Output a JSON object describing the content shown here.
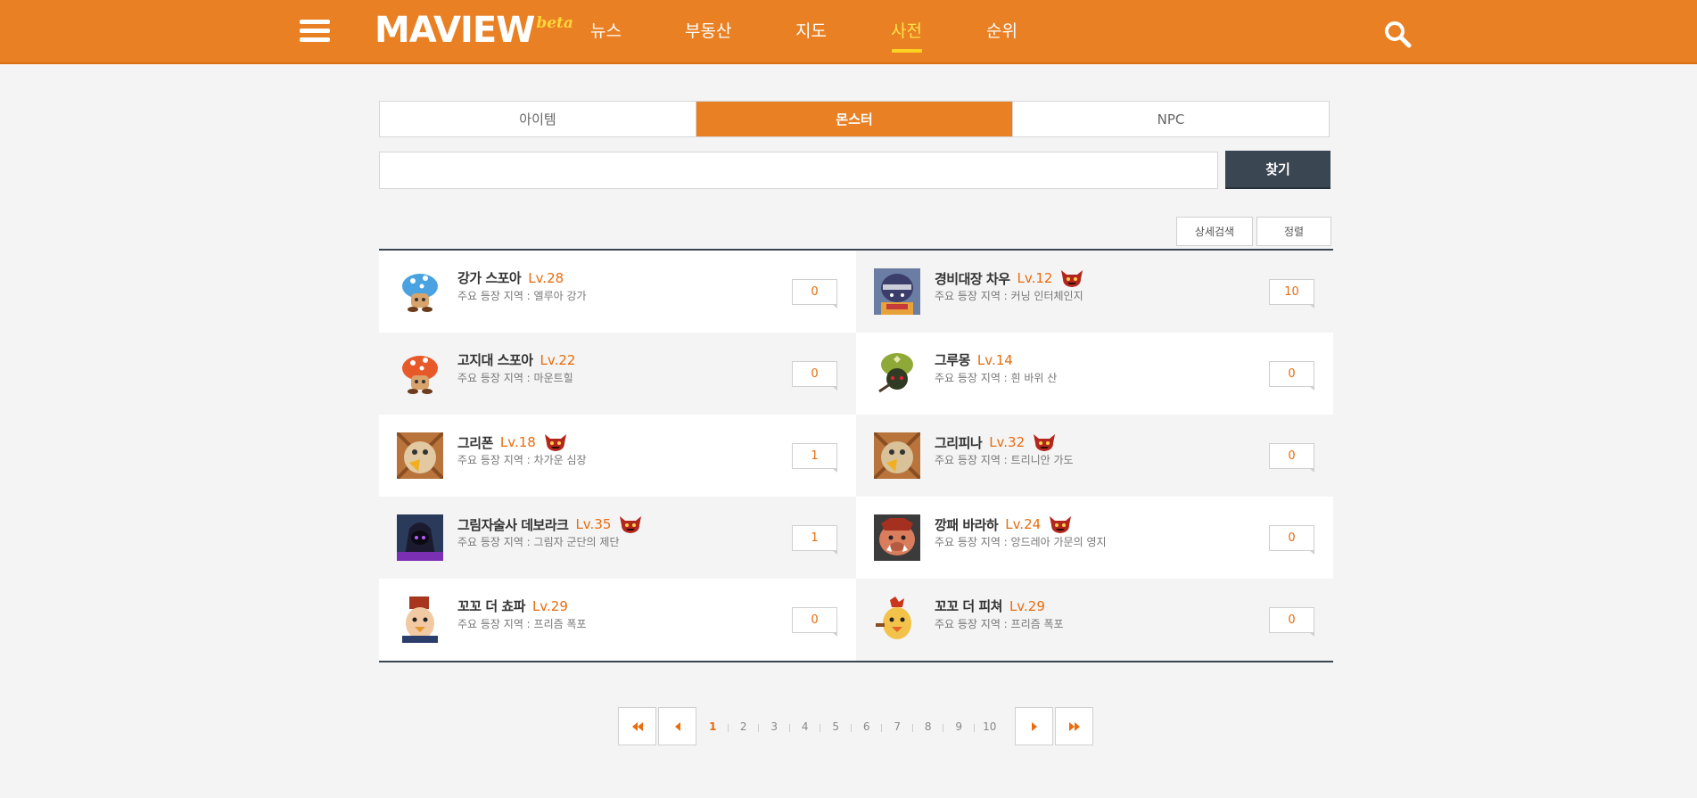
{
  "brand": {
    "name": "MAVIEW",
    "badge": "beta"
  },
  "nav": {
    "items": [
      {
        "label": "뉴스",
        "active": false
      },
      {
        "label": "부동산",
        "active": false
      },
      {
        "label": "지도",
        "active": false
      },
      {
        "label": "사전",
        "active": true
      },
      {
        "label": "순위",
        "active": false
      }
    ]
  },
  "category_tabs": [
    {
      "label": "아이템",
      "active": false
    },
    {
      "label": "몬스터",
      "active": true
    },
    {
      "label": "NPC",
      "active": false
    }
  ],
  "search": {
    "value": "",
    "placeholder": "",
    "button_label": "찾기"
  },
  "filters": {
    "advanced_label": "상세검색",
    "sort_label": "정렬"
  },
  "region_prefix": "주요 등장 지역 : ",
  "monsters": [
    {
      "name": "강가 스포아",
      "level": "Lv.28",
      "boss": false,
      "region": "주요 등장 지역 : 엘루아 강가",
      "count": "0",
      "icon": "blue-mushroom"
    },
    {
      "name": "경비대장 차우",
      "level": "Lv.12",
      "boss": true,
      "region": "주요 등장 지역 : 커닝 인터체인지",
      "count": "10",
      "icon": "armored-guard"
    },
    {
      "name": "고지대 스포아",
      "level": "Lv.22",
      "boss": false,
      "region": "주요 등장 지역 : 마운트힐",
      "count": "0",
      "icon": "orange-mushroom"
    },
    {
      "name": "그루몽",
      "level": "Lv.14",
      "boss": false,
      "region": "주요 등장 지역 : 흰 바위 산",
      "count": "0",
      "icon": "green-sprout"
    },
    {
      "name": "그리폰",
      "level": "Lv.18",
      "boss": true,
      "region": "주요 등장 지역 : 차가운 심장",
      "count": "1",
      "icon": "griffin"
    },
    {
      "name": "그리피나",
      "level": "Lv.32",
      "boss": true,
      "region": "주요 등장 지역 : 트리니안 가도",
      "count": "0",
      "icon": "griffin"
    },
    {
      "name": "그림자술사 데보라크",
      "level": "Lv.35",
      "boss": true,
      "region": "주요 등장 지역 : 그림자 군단의 제단",
      "count": "1",
      "icon": "shadow-mage"
    },
    {
      "name": "깡패 바라하",
      "level": "Lv.24",
      "boss": true,
      "region": "주요 등장 지역 : 앙드레아 가문의 영지",
      "count": "0",
      "icon": "boar-thug"
    },
    {
      "name": "꼬꼬 더 쵸파",
      "level": "Lv.29",
      "boss": false,
      "region": "주요 등장 지역 : 프리즘 폭포",
      "count": "0",
      "icon": "rooster-chef"
    },
    {
      "name": "꼬꼬 더 피쳐",
      "level": "Lv.29",
      "boss": false,
      "region": "주요 등장 지역 : 프리즘 폭포",
      "count": "0",
      "icon": "rooster-pitcher"
    }
  ],
  "pagination": {
    "first_icon": "double-left-icon",
    "prev_icon": "left-icon",
    "next_icon": "right-icon",
    "last_icon": "double-right-icon",
    "pages": [
      "1",
      "2",
      "3",
      "4",
      "5",
      "6",
      "7",
      "8",
      "9",
      "10"
    ],
    "current": "1"
  },
  "colors": {
    "brand": "#e98024",
    "dark": "#3a4651",
    "accent_text": "#e96c0e",
    "nav_active": "#ffe14a"
  }
}
